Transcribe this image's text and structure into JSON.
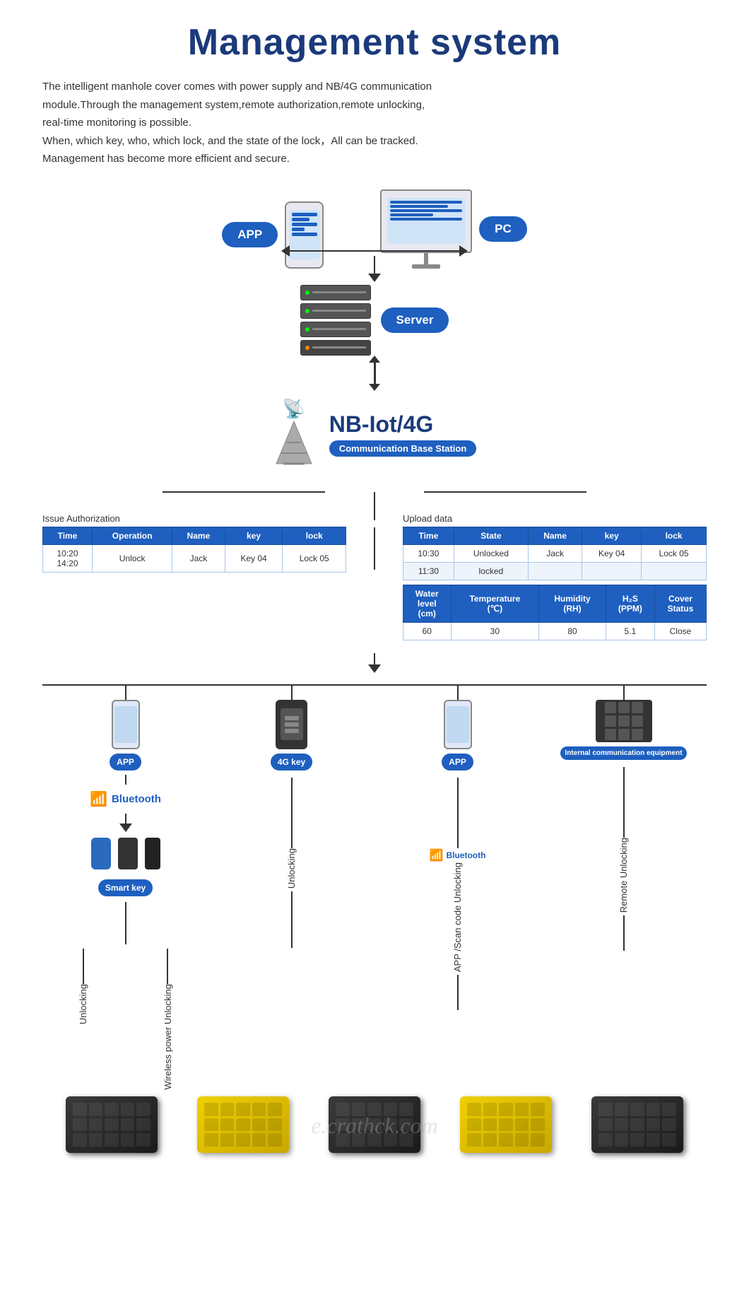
{
  "page": {
    "title": "Management system",
    "description_lines": [
      "The intelligent manhole cover comes with power supply and NB/4G communication",
      "module.Through the management system,remote authorization,remote unlocking,",
      "real-time monitoring is possible.",
      "When, which key, who, which lock, and the state of the lock，All can be tracked.",
      "Management has become more efficient and secure."
    ]
  },
  "badges": {
    "app": "APP",
    "pc": "PC",
    "server": "Server",
    "nb_iot": "NB-Iot/4G",
    "comm_base": "Communication Base Station",
    "app2": "APP",
    "key_4g": "4G key",
    "app3": "APP",
    "internal": "Internal communication equipment",
    "smart_key": "Smart key",
    "bluetooth": "Bluetooth"
  },
  "issue_table": {
    "label": "Issue Authorization",
    "headers": [
      "Time",
      "Operation",
      "Name",
      "key",
      "lock"
    ],
    "rows": [
      [
        "10:20",
        "Unlock",
        "Jack",
        "Key 04",
        "Lock 05"
      ],
      [
        "14:20",
        "",
        "",
        "",
        ""
      ]
    ]
  },
  "upload_table": {
    "label": "Upload data",
    "headers1": [
      "Time",
      "State",
      "Name",
      "key",
      "lock"
    ],
    "rows1": [
      [
        "10:30",
        "Unlocked",
        "Jack",
        "Key 04",
        "Lock 05"
      ],
      [
        "11:30",
        "locked",
        "",
        "",
        ""
      ]
    ],
    "headers2": [
      "Water level (cm)",
      "Temperature (℃)",
      "Humidity (RH)",
      "H₂S (PPM)",
      "Cover Status"
    ],
    "rows2": [
      [
        "60",
        "30",
        "80",
        "5.1",
        "Close"
      ]
    ]
  },
  "rotated_labels": {
    "unlocking1": "Unlocking",
    "wireless_unlocking": "Wireless power Unlocking",
    "unlocking2": "Unlocking",
    "app_scan": "APP /Scan code Unlocking",
    "remote": "Remote Unlocking"
  },
  "watermark": "e.crathck.com"
}
